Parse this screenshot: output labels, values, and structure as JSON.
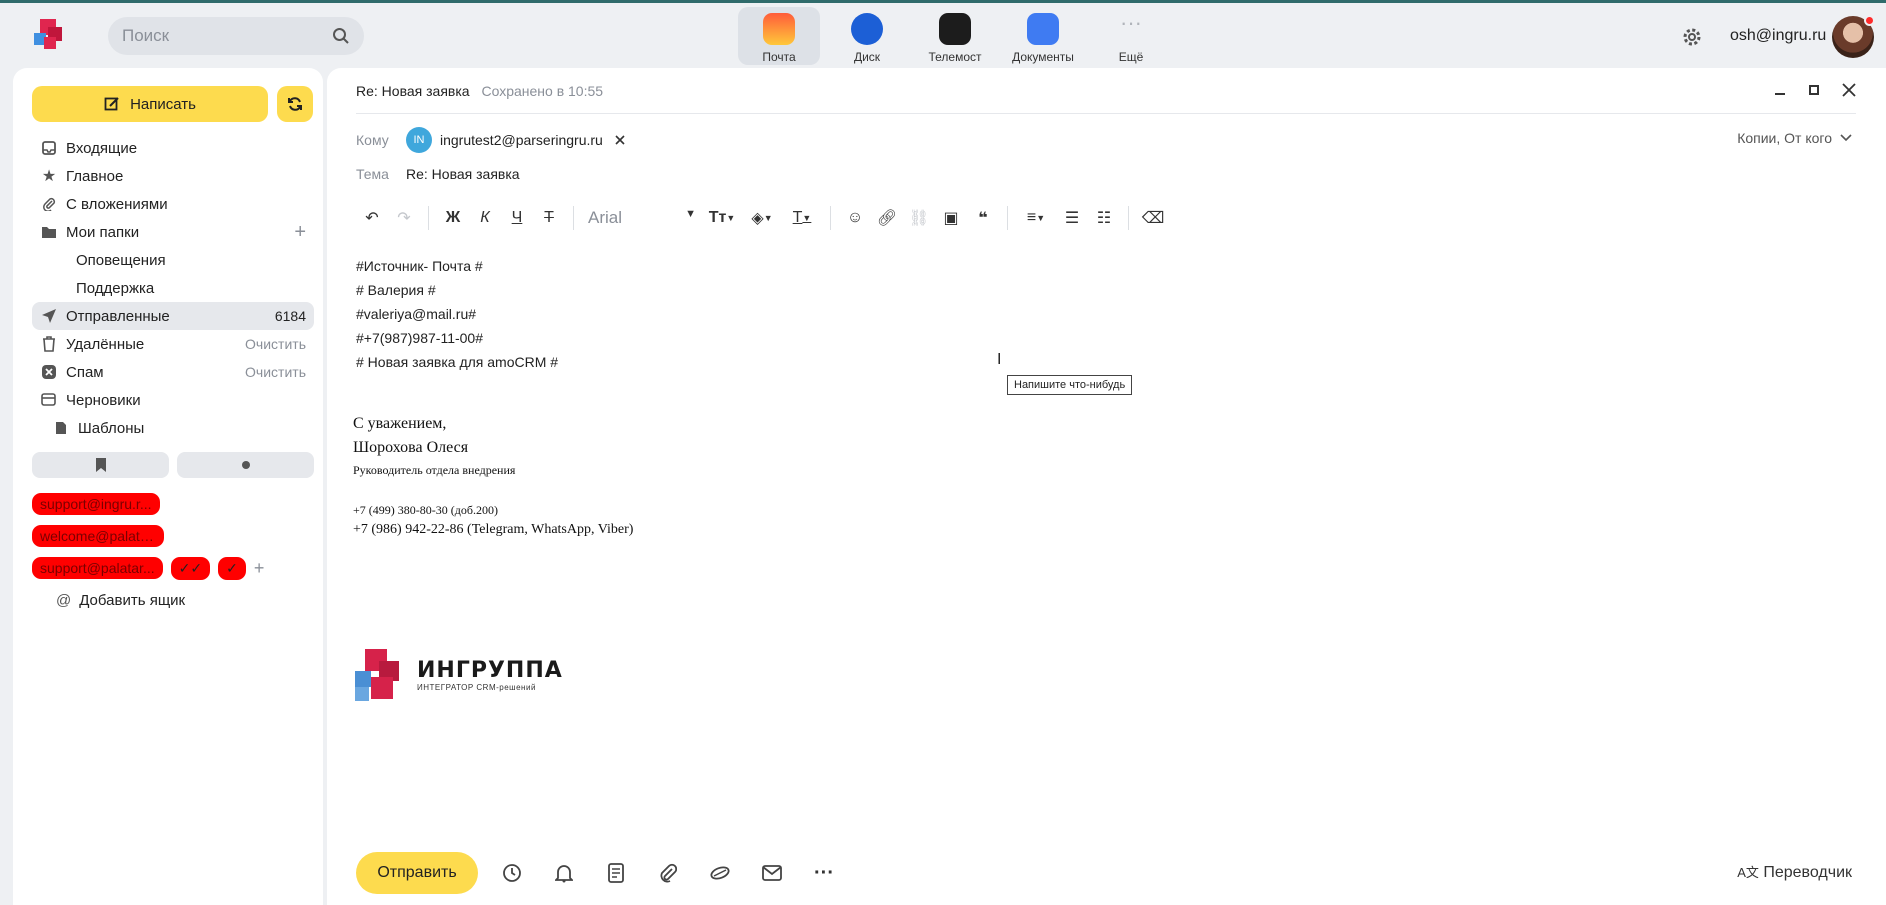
{
  "header": {
    "search_placeholder": "Поиск",
    "apps": [
      {
        "label": "Почта",
        "color": "#ff9a3c"
      },
      {
        "label": "Диск",
        "color": "#1c5fd6"
      },
      {
        "label": "Телемост",
        "color": "#1c1c1c"
      },
      {
        "label": "Документы",
        "color": "#3f7bf2"
      },
      {
        "label": "Ещё",
        "color": "#b0b4ba"
      }
    ],
    "user_email": "osh@ingru.ru"
  },
  "sidebar": {
    "compose_label": "Написать",
    "folders": [
      {
        "label": "Входящие",
        "icon": "inbox-icon"
      },
      {
        "label": "Главное",
        "icon": "star-icon"
      },
      {
        "label": "С вложениями",
        "icon": "paperclip-icon"
      },
      {
        "label": "Мои папки",
        "icon": "folder-icon",
        "right": "+"
      },
      {
        "label": "Оповещения",
        "sub": true
      },
      {
        "label": "Поддержка",
        "sub": true
      },
      {
        "label": "Отправленные",
        "icon": "send-icon",
        "right": "6184",
        "active": true
      },
      {
        "label": "Удалённые",
        "icon": "trash-icon",
        "right": "Очистить"
      },
      {
        "label": "Спам",
        "icon": "spam-icon",
        "right": "Очистить"
      },
      {
        "label": "Черновики",
        "icon": "drafts-icon"
      },
      {
        "label": "Шаблоны",
        "icon": "template-icon",
        "sub_icon": true
      }
    ],
    "labels": [
      "support@ingru.r...",
      "welcome@palatar...",
      "support@palatar...",
      "✓✓",
      "✓"
    ],
    "add_mailbox": "Добавить ящик"
  },
  "compose": {
    "title": "Re: Новая заявка",
    "saved": "Сохранено в 10:55",
    "to_label": "Кому",
    "to_initials": "IN",
    "to_email": "ingrutest2@parseringru.ru",
    "cc_label": "Копии, От кого",
    "subject_label": "Тема",
    "subject": "Re: Новая заявка",
    "font_name": "Arial",
    "body_lines": [
      "#Источник- Почта #",
      "# Валерия #",
      "#valeriya@mail.ru#",
      "#+7(987)987-11-00#",
      "# Новая заявка для amoCRM #"
    ],
    "tooltip": "Напишите что-нибудь",
    "signature": {
      "greeting": "С уважением,",
      "name": "Шорохова Олеся",
      "position": "Руководитель отдела внедрения",
      "phone1": "+7 (499) 380-80-30 (доб.200)",
      "phone2": "+7 (986) 942-22-86 (Telegram, WhatsApp, Viber)",
      "company": "ИНГРУППА",
      "company_sub": "ИНТЕГРАТОР CRM-решений"
    },
    "send_label": "Отправить",
    "translator_label": "Переводчик"
  }
}
